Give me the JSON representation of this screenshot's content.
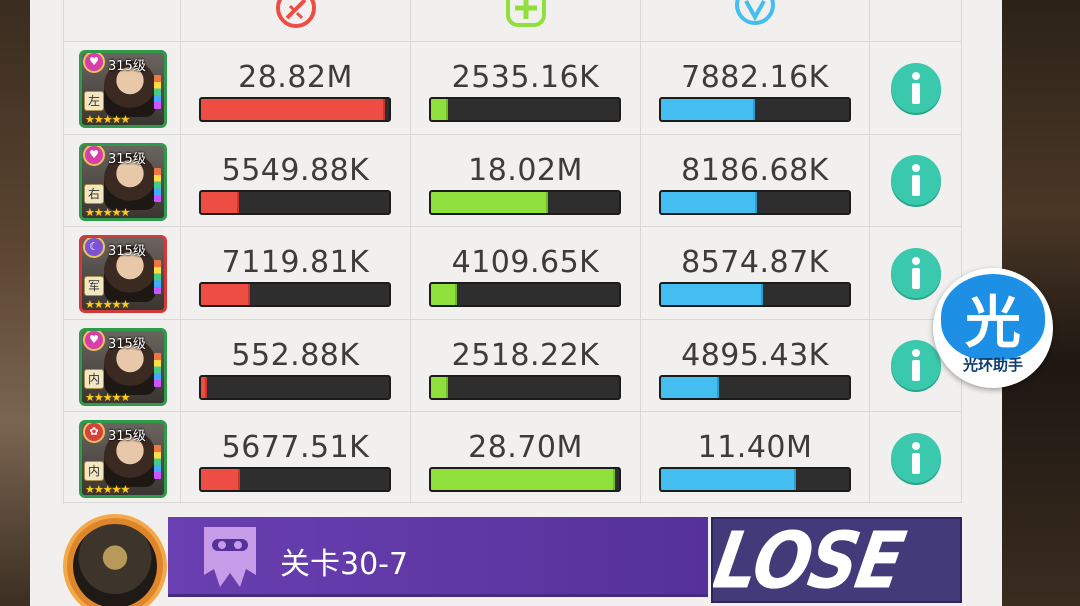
{
  "headers": {
    "damage_icon": "broken-sword-icon",
    "heal_icon": "plus-cross-icon",
    "defense_icon": "shield-icon",
    "colors": {
      "damage": "#ee4d44",
      "heal": "#8fe03d",
      "defense": "#44bdf0",
      "info": "#3ac9ac"
    }
  },
  "rows": [
    {
      "level": "315级",
      "faction": "左",
      "gem": "heart",
      "frame": "green",
      "stars": "★★★★★",
      "damage": "28.82M",
      "damage_fill": 0.98,
      "heal": "2535.16K",
      "heal_fill": 0.09,
      "defense": "7882.16K",
      "defense_fill": 0.5
    },
    {
      "level": "315级",
      "faction": "右",
      "gem": "heart",
      "frame": "green",
      "stars": "★★★★★",
      "damage": "5549.88K",
      "damage_fill": 0.2,
      "heal": "18.02M",
      "heal_fill": 0.62,
      "defense": "8186.68K",
      "defense_fill": 0.51
    },
    {
      "level": "315级",
      "faction": "军",
      "gem": "moon",
      "frame": "red",
      "stars": "★★★★★",
      "damage": "7119.81K",
      "damage_fill": 0.26,
      "heal": "4109.65K",
      "heal_fill": 0.14,
      "defense": "8574.87K",
      "defense_fill": 0.54
    },
    {
      "level": "315级",
      "faction": "内",
      "gem": "heart",
      "frame": "green",
      "stars": "★★★★★",
      "damage": "552.88K",
      "damage_fill": 0.03,
      "heal": "2518.22K",
      "heal_fill": 0.09,
      "defense": "4895.43K",
      "defense_fill": 0.31
    },
    {
      "level": "315级",
      "faction": "内",
      "gem": "red",
      "frame": "green",
      "stars": "★★★★★",
      "damage": "5677.51K",
      "damage_fill": 0.21,
      "heal": "28.70M",
      "heal_fill": 0.98,
      "defense": "11.40M",
      "defense_fill": 0.72
    }
  ],
  "footer": {
    "stage_label": "关卡30-7",
    "result": "LOSE"
  },
  "watermark": {
    "glyph": "光",
    "label": "光环助手"
  }
}
